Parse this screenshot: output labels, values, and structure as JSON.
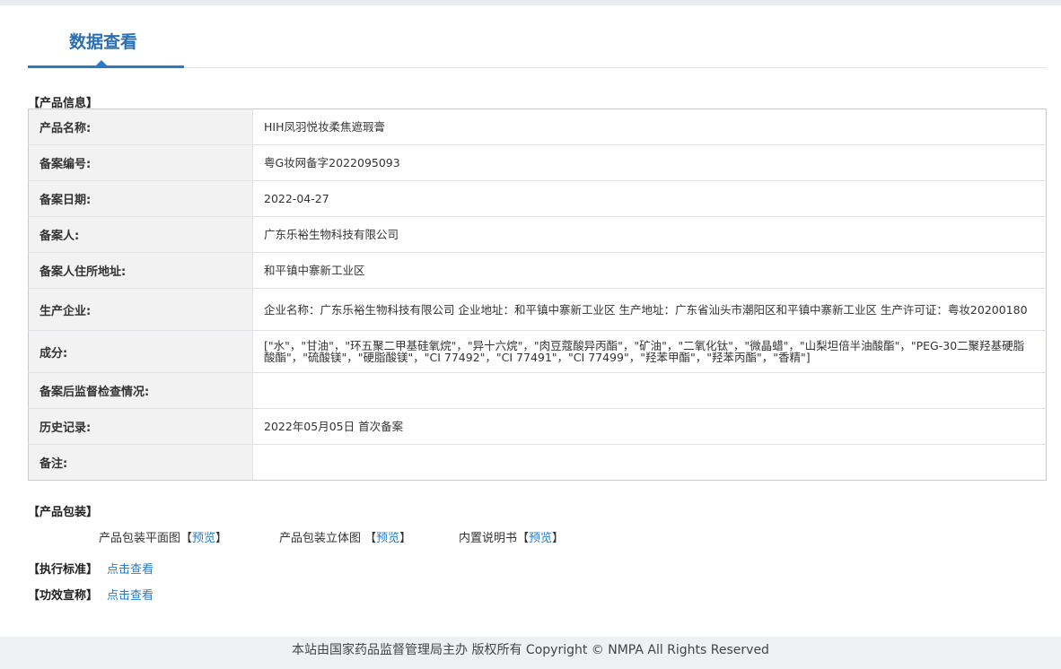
{
  "page": {
    "tab_title": "数据查看"
  },
  "product_info": {
    "section_title": "【产品信息】",
    "rows": [
      {
        "label": "产品名称:",
        "value": "HIH凤羽悦妆柔焦遮瑕膏"
      },
      {
        "label": "备案编号:",
        "value": "粤G妆网备字2022095093"
      },
      {
        "label": "备案日期:",
        "value": "2022-04-27"
      },
      {
        "label": "备案人:",
        "value": "广东乐裕生物科技有限公司"
      },
      {
        "label": "备案人住所地址:",
        "value": "和平镇中寨新工业区"
      },
      {
        "label": "生产企业:",
        "value": "企业名称：广东乐裕生物科技有限公司 企业地址：和平镇中寨新工业区 生产地址：广东省汕头市潮阳区和平镇中寨新工业区 生产许可证：粤妆20200180"
      },
      {
        "label": "成分:",
        "value": "[\"水\"，\"甘油\"，\"环五聚二甲基硅氧烷\"，\"异十六烷\"，\"肉豆蔻酸异丙酯\"，\"矿油\"，\"二氧化钛\"，\"微晶蜡\"，\"山梨坦倍半油酸酯\"，\"PEG-30二聚羟基硬脂酸酯\"，\"硫酸镁\"，\"硬脂酸镁\"，\"CI 77492\"，\"CI 77491\"，\"CI 77499\"，\"羟苯甲酯\"，\"羟苯丙酯\"，\"香精\"]"
      },
      {
        "label": "备案后监督检查情况:",
        "value": ""
      },
      {
        "label": "历史记录:",
        "value": "2022年05月05日 首次备案"
      },
      {
        "label": "备注:",
        "value": ""
      }
    ]
  },
  "packaging": {
    "section_title": "【产品包装】",
    "items": [
      {
        "label": "产品包装平面图",
        "link": "预览"
      },
      {
        "label": "产品包装立体图 ",
        "link": "预览"
      },
      {
        "label": "内置说明书",
        "link": "预览"
      }
    ]
  },
  "standard": {
    "label": "【执行标准】",
    "link": "点击查看"
  },
  "efficacy": {
    "label": "【功效宣称】",
    "link": "点击查看"
  },
  "footer": {
    "text": "本站由国家药品监督管理局主办 版权所有 Copyright © NMPA All Rights Reserved"
  }
}
